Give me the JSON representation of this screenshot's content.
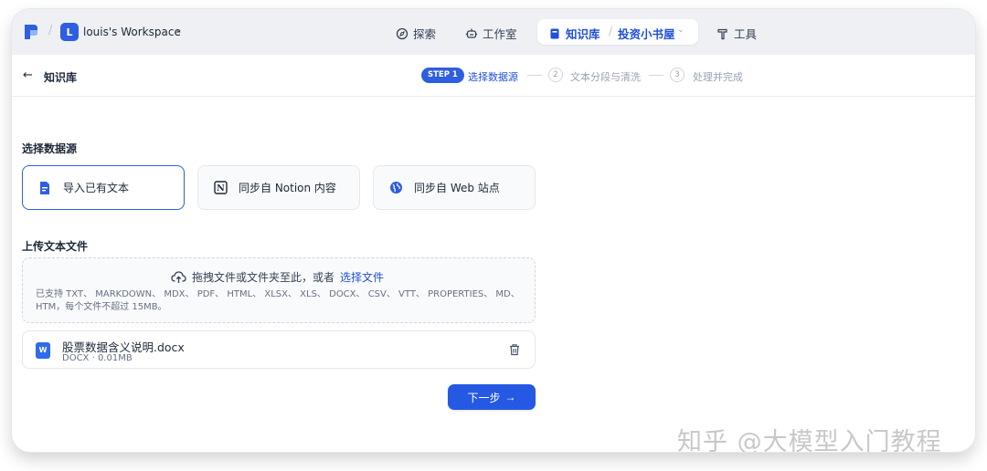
{
  "header": {
    "workspace_initial": "L",
    "workspace_name": "louis's Workspace",
    "nav": {
      "explore": "探索",
      "studio": "工作室",
      "knowledge": "知识库",
      "knowledge_sub": "投资小书屋",
      "tools": "工具"
    }
  },
  "stepbar": {
    "back_title": "知识库",
    "step1_badge": "STEP 1",
    "step1_label": "选择数据源",
    "step2_num": "2",
    "step2_label": "文本分段与清洗",
    "step3_num": "3",
    "step3_label": "处理并完成"
  },
  "content": {
    "source_title": "选择数据源",
    "sources": [
      {
        "label": "导入已有文本",
        "icon": "document-icon",
        "selected": true
      },
      {
        "label": "同步自 Notion 内容",
        "icon": "notion-icon",
        "selected": false
      },
      {
        "label": "同步自 Web 站点",
        "icon": "globe-icon",
        "selected": false
      }
    ],
    "upload_title": "上传文本文件",
    "dropzone": {
      "text": "拖拽文件或文件夹至此，或者",
      "link": "选择文件",
      "hint": "已支持 TXT、 MARKDOWN、 MDX、 PDF、 HTML、 XLSX、 XLS、 DOCX、 CSV、 VTT、 PROPERTIES、 MD、 HTM，每个文件不超过 15MB。"
    },
    "file": {
      "icon_letter": "W",
      "name": "股票数据含义说明.docx",
      "meta": "DOCX · 0.01MB"
    },
    "next_label": "下一步"
  },
  "watermark": "知乎 @大模型入门教程",
  "colors": {
    "accent": "#2f5ee0",
    "nav_bg": "#eef0f4",
    "muted": "#98a2b3"
  }
}
